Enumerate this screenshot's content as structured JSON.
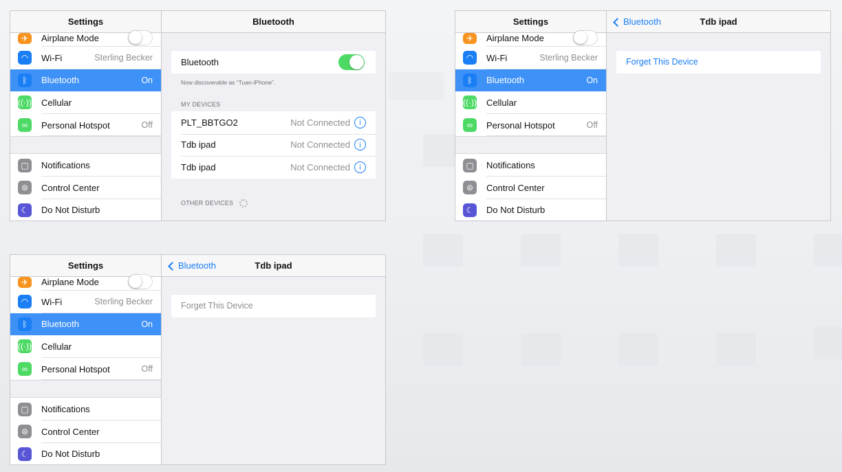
{
  "colors": {
    "accent": "#1a7ef5",
    "selection": "#3e91f6",
    "toggle_on": "#4cd964",
    "airplane_icon": "#f7931e",
    "wifi_icon": "#1a7ef5",
    "bluetooth_icon": "#1a7ef5",
    "cellular_icon": "#4cd964",
    "hotspot_icon": "#4cd964",
    "notifications_icon": "#8e8e93",
    "control_center_icon": "#8e8e93",
    "dnd_icon": "#5856d6"
  },
  "sidebar": {
    "title": "Settings",
    "items": [
      {
        "label": "Airplane Mode",
        "icon": "airplane-icon",
        "control": "toggle-off"
      },
      {
        "label": "Wi-Fi",
        "icon": "wifi-icon",
        "value": "Sterling Becker"
      },
      {
        "label": "Bluetooth",
        "icon": "bluetooth-icon",
        "value": "On",
        "selected": true
      },
      {
        "label": "Cellular",
        "icon": "cellular-icon"
      },
      {
        "label": "Personal Hotspot",
        "icon": "hotspot-icon",
        "value": "Off"
      },
      {
        "label": "Notifications",
        "icon": "notifications-icon"
      },
      {
        "label": "Control Center",
        "icon": "control-center-icon"
      },
      {
        "label": "Do Not Disturb",
        "icon": "moon-icon"
      }
    ]
  },
  "panel1": {
    "title": "Bluetooth",
    "bluetooth_label": "Bluetooth",
    "bluetooth_toggle": "on",
    "discoverable_note": "Now discoverable as “Tuan-iPhone”.",
    "my_devices_header": "MY DEVICES",
    "devices": [
      {
        "name": "PLT_BBTGO2",
        "status": "Not Connected"
      },
      {
        "name": "Tdb ipad",
        "status": "Not Connected"
      },
      {
        "name": "Tdb ipad",
        "status": "Not Connected"
      }
    ],
    "other_devices_header": "OTHER DEVICES"
  },
  "panel2": {
    "back_label": "Bluetooth",
    "title": "Tdb ipad",
    "forget_label": "Forget This Device"
  },
  "panel3": {
    "back_label": "Bluetooth",
    "title": "Tdb ipad",
    "forget_label": "Forget This Device"
  }
}
